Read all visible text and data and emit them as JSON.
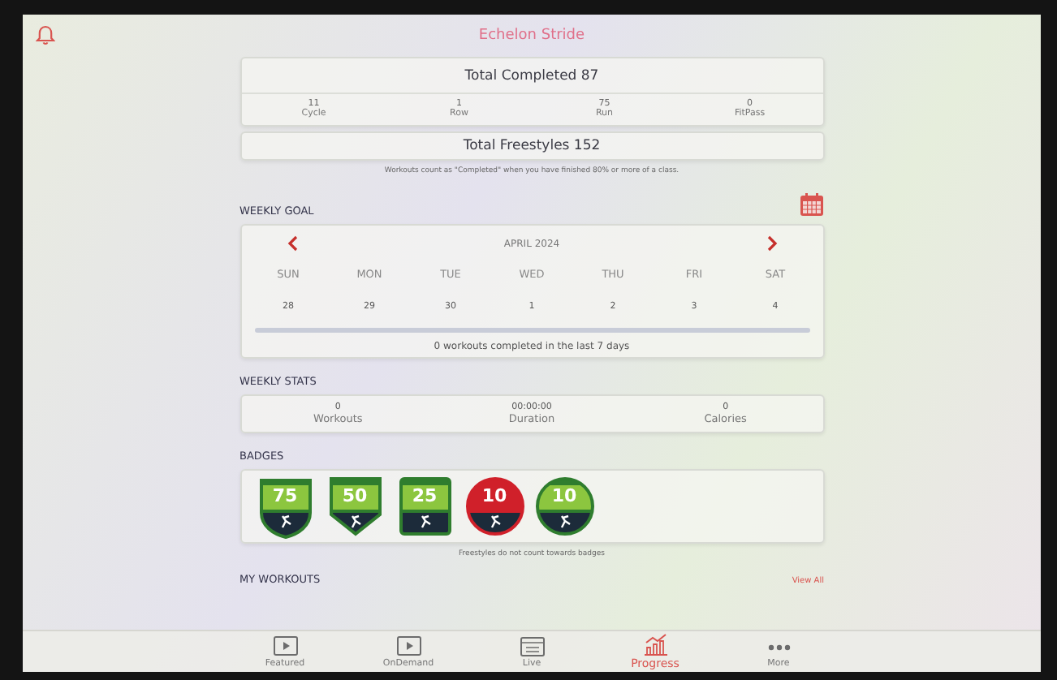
{
  "header": {
    "title": "Echelon Stride"
  },
  "totals": {
    "completed_label": "Total Completed",
    "completed_value": "87",
    "types": [
      {
        "value": "11",
        "label": "Cycle"
      },
      {
        "value": "1",
        "label": "Row"
      },
      {
        "value": "75",
        "label": "Run"
      },
      {
        "value": "0",
        "label": "FitPass"
      }
    ],
    "freestyles_label": "Total Freestyles",
    "freestyles_value": "152",
    "note": "Workouts count as \"Completed\" when you have finished 80% or more of a class."
  },
  "weekly_goal": {
    "heading": "WEEKLY GOAL",
    "month": "APRIL 2024",
    "days": [
      {
        "name": "SUN",
        "date": "28"
      },
      {
        "name": "MON",
        "date": "29"
      },
      {
        "name": "TUE",
        "date": "30"
      },
      {
        "name": "WED",
        "date": "1"
      },
      {
        "name": "THU",
        "date": "2"
      },
      {
        "name": "FRI",
        "date": "3"
      },
      {
        "name": "SAT",
        "date": "4"
      }
    ],
    "level": 0,
    "summary": "0 workouts completed in the last 7 days"
  },
  "weekly_stats": {
    "heading": "WEEKLY STATS",
    "items": [
      {
        "value": "0",
        "label": "Workouts"
      },
      {
        "value": "00:00:00",
        "label": "Duration"
      },
      {
        "value": "0",
        "label": "Calories"
      }
    ]
  },
  "badges": {
    "heading": "BADGES",
    "items": [
      {
        "kind": "shield",
        "number": "75",
        "color": "#2f7d2e"
      },
      {
        "kind": "crest",
        "number": "50",
        "color": "#2f7d2e"
      },
      {
        "kind": "square",
        "number": "25",
        "color": "#2f7d2e"
      },
      {
        "kind": "circle",
        "number": "10",
        "color": "#d0202a"
      },
      {
        "kind": "circle",
        "number": "10",
        "color": "#2f7d2e"
      }
    ],
    "note": "Freestyles do not count towards badges"
  },
  "my_workouts": {
    "heading": "MY WORKOUTS",
    "link": "View All"
  },
  "tab_bar": [
    {
      "label": "Featured",
      "kind": "screen",
      "selected": false
    },
    {
      "label": "OnDemand",
      "kind": "screen",
      "selected": false
    },
    {
      "label": "Live",
      "kind": "calendar",
      "selected": false
    },
    {
      "label": "Progress",
      "kind": "chart",
      "selected": true
    },
    {
      "label": "More",
      "kind": "dots",
      "selected": false
    }
  ]
}
